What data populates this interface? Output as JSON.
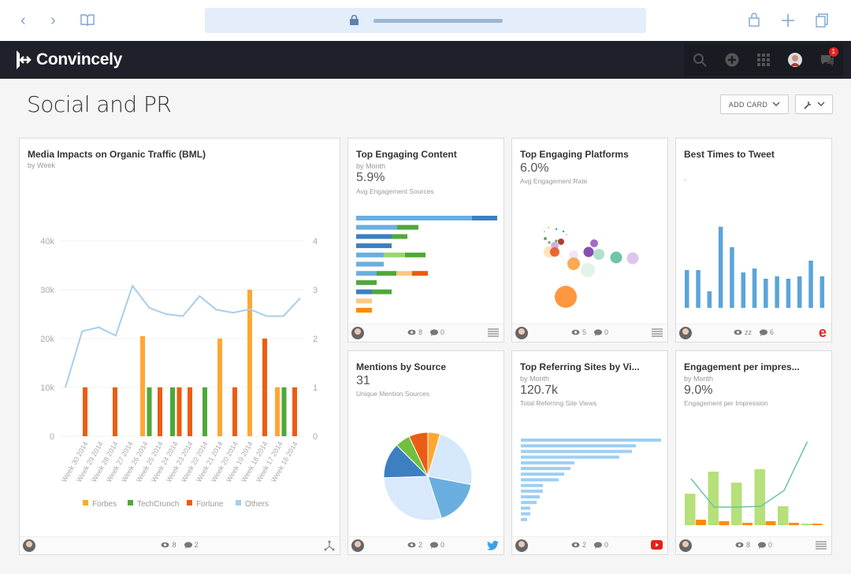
{
  "browser": {
    "back_icon": "chevron-left",
    "forward_icon": "chevron-right",
    "bookmarks_icon": "book",
    "lock_icon": "lock",
    "share_icon": "lock-share",
    "new_tab_icon": "plus",
    "tabs_icon": "tabs"
  },
  "nav": {
    "brand": "Convincely",
    "notification_count": "1",
    "icons": [
      "search",
      "add-circle",
      "apps-grid",
      "user-avatar",
      "chat"
    ]
  },
  "page": {
    "title": "Social and PR",
    "add_card_label": "ADD CARD",
    "settings_icon": "wrench"
  },
  "colors": {
    "forbes": "#ffa733",
    "techcrunch": "#4fa83a",
    "fortune": "#eb5d12",
    "others": "#a8cdee",
    "blue": "#5aa5da"
  },
  "cards": {
    "media": {
      "title": "Media Impacts on Organic Traffic (BML)",
      "subtitle": "by Week",
      "views": "8",
      "comments": "2",
      "right_icon": "share-network"
    },
    "content": {
      "title": "Top Engaging Content",
      "subtitle": "by Month",
      "value": "5.9%",
      "label": "Avg Engagement Sources",
      "views": "8",
      "comments": "0",
      "right_icon": "list"
    },
    "platforms": {
      "title": "Top Engaging Platforms",
      "value": "6.0%",
      "label": "Avg Engagement Rate",
      "views": "5",
      "comments": "0",
      "right_icon": "list"
    },
    "tweet": {
      "title": "Best Times to Tweet",
      "views": "zz",
      "comments": "6",
      "right_icon": "e-brand"
    },
    "mentions": {
      "title": "Mentions by Source",
      "value": "31",
      "label": "Unique Mention Sources",
      "views": "2",
      "comments": "0",
      "right_icon": "twitter"
    },
    "referring": {
      "title": "Top Referring Sites by Vi...",
      "subtitle": "by Month",
      "value": "120.7k",
      "label": "Total Referring Site Views",
      "views": "2",
      "comments": "0",
      "right_icon": "youtube"
    },
    "engagement": {
      "title": "Engagement per impres...",
      "subtitle": "by Month",
      "value": "9.0%",
      "label": "Engagement per Impression",
      "views": "8",
      "comments": "0",
      "right_icon": "list"
    }
  },
  "chart_data": [
    {
      "id": "media",
      "type": "bar+line",
      "categories": [
        "Week 30 2014",
        "Week 29 2014",
        "Week 28 2014",
        "Week 27 2014",
        "Week 26 2014",
        "Week 25 2014",
        "Week 24 2014",
        "Week 23 2014",
        "Week 22 2014",
        "Week 21 2014",
        "Week 20 2014",
        "Week 19 2014",
        "Week 18 2014",
        "Week 17 2014",
        "Week 16 2014"
      ],
      "left_ticks": [
        "0",
        "10k",
        "20k",
        "30k",
        "40k"
      ],
      "right_ticks": [
        "0",
        "1",
        "2",
        "3",
        "4"
      ],
      "ylim_left": [
        0,
        40000
      ],
      "ylim_right": [
        0,
        4
      ],
      "grid": true,
      "legend": "bottom",
      "series": [
        {
          "name": "Forbes",
          "type": "bar",
          "axis": "right",
          "color": "#ffa733",
          "values": [
            0,
            0,
            0,
            0,
            2.05,
            0,
            0,
            0,
            0,
            2,
            0,
            3,
            0,
            1,
            0
          ]
        },
        {
          "name": "TechCrunch",
          "type": "bar",
          "axis": "right",
          "color": "#4fa83a",
          "values": [
            0,
            0,
            0,
            0,
            1,
            0,
            1,
            0,
            1,
            0,
            0,
            0,
            0,
            1,
            0
          ]
        },
        {
          "name": "Fortune",
          "type": "bar",
          "axis": "right",
          "color": "#eb5d12",
          "values": [
            1,
            0,
            1,
            0,
            0,
            1,
            1,
            1,
            0,
            0,
            1,
            0,
            2,
            0,
            1
          ]
        },
        {
          "name": "Others",
          "type": "line",
          "axis": "left",
          "color": "#a8cdee",
          "values": [
            10000,
            21500,
            22300,
            20600,
            30800,
            26300,
            25000,
            24600,
            28700,
            25900,
            25300,
            26000,
            24600,
            24600,
            28300
          ]
        }
      ]
    },
    {
      "id": "content",
      "type": "stacked-bar-horizontal",
      "rows": [
        [
          [
            "#6aaee0",
            147
          ],
          [
            "#3d7fc0",
            32
          ]
        ],
        [
          [
            "#6aaee0",
            52
          ],
          [
            "#4fa83a",
            27
          ]
        ],
        [
          [
            "#3d7fc0",
            45
          ],
          [
            "#4fa83a",
            20
          ]
        ],
        [
          [
            "#3d7fc0",
            45
          ]
        ],
        [
          [
            "#6aaee0",
            35
          ],
          [
            "#9bd56a",
            27
          ],
          [
            "#4fa83a",
            26
          ]
        ],
        [
          [
            "#6aaee0",
            35
          ]
        ],
        [
          [
            "#6aaee0",
            26
          ],
          [
            "#4fa83a",
            25
          ],
          [
            "#ffc880",
            20
          ],
          [
            "#e85d12",
            20
          ]
        ],
        [
          [
            "#4fa83a",
            26
          ]
        ],
        [
          [
            "#3d7fc0",
            20
          ],
          [
            "#4fa83a",
            25
          ]
        ],
        [
          [
            "#ffc880",
            20
          ]
        ],
        [
          [
            "#ff8c00",
            20
          ]
        ]
      ]
    },
    {
      "id": "platforms",
      "type": "bubble",
      "points": [
        {
          "x": 41,
          "y": 118,
          "r": 0.8,
          "c": "#4fa83a"
        },
        {
          "x": 46,
          "y": 113,
          "r": 1,
          "c": "#ffa733"
        },
        {
          "x": 56,
          "y": 115,
          "r": 1.2,
          "c": "#3d7fc0"
        },
        {
          "x": 65,
          "y": 118,
          "r": 1.2,
          "c": "#3d7fc0"
        },
        {
          "x": 69,
          "y": 122,
          "r": 1,
          "c": "#a8cdee"
        },
        {
          "x": 42,
          "y": 127,
          "r": 2,
          "c": "#4fa83a"
        },
        {
          "x": 47,
          "y": 132,
          "r": 1.6,
          "c": "#4fa83a"
        },
        {
          "x": 56,
          "y": 130,
          "r": 1.6,
          "c": "#4fa83a"
        },
        {
          "x": 62,
          "y": 131,
          "r": 4,
          "c": "#a52a1a"
        },
        {
          "x": 54,
          "y": 136,
          "r": 5,
          "c": "#c9a6e0"
        },
        {
          "x": 47,
          "y": 144,
          "r": 7,
          "c": "#ffe0b0"
        },
        {
          "x": 54,
          "y": 144,
          "r": 6,
          "c": "#e8561c"
        },
        {
          "x": 104,
          "y": 133,
          "r": 5,
          "c": "#9b59c0"
        },
        {
          "x": 97,
          "y": 144,
          "r": 6.5,
          "c": "#7b3aa8"
        },
        {
          "x": 78,
          "y": 148,
          "r": 6,
          "c": "#efe3f7"
        },
        {
          "x": 110,
          "y": 147,
          "r": 7,
          "c": "#a8dcc8"
        },
        {
          "x": 132,
          "y": 151,
          "r": 7.5,
          "c": "#5fbfa0"
        },
        {
          "x": 153,
          "y": 152,
          "r": 7.5,
          "c": "#d9c0ec"
        },
        {
          "x": 78,
          "y": 159,
          "r": 8,
          "c": "#ffa040"
        },
        {
          "x": 96,
          "y": 167,
          "r": 9,
          "c": "#dff2e6"
        },
        {
          "x": 68,
          "y": 201,
          "r": 14,
          "c": "#ff8c2a"
        }
      ]
    },
    {
      "id": "tweet",
      "type": "bar",
      "values": [
        48,
        48,
        21,
        103,
        77,
        45,
        50,
        37,
        40,
        37,
        40,
        60,
        40
      ],
      "color": "#5aa5da"
    },
    {
      "id": "mentions",
      "type": "pie",
      "slices": [
        {
          "v": 4.5,
          "c": "#ffa733"
        },
        {
          "v": 23.5,
          "c": "#d6e8fb"
        },
        {
          "v": 17,
          "c": "#6aaee0"
        },
        {
          "v": 29.5,
          "c": "#d9e9fb"
        },
        {
          "v": 13,
          "c": "#3d7fc0"
        },
        {
          "v": 5.5,
          "c": "#72c040"
        },
        {
          "v": 7,
          "c": "#eb5d12"
        }
      ]
    },
    {
      "id": "referring",
      "type": "bar-horizontal",
      "values": [
        178,
        146,
        141,
        125,
        68,
        63,
        55,
        48,
        28,
        28,
        24,
        20,
        12,
        12,
        8
      ],
      "color": "#9ccff5"
    },
    {
      "id": "engagement",
      "type": "bar+line",
      "green": [
        40,
        68,
        54,
        71,
        24,
        2
      ],
      "orange": [
        7,
        5,
        3,
        5,
        3,
        2
      ],
      "line": [
        59,
        23,
        23,
        24,
        44,
        106
      ],
      "colors": [
        "#b5e07a",
        "#ff8c00",
        "#6cc4a4"
      ]
    }
  ]
}
